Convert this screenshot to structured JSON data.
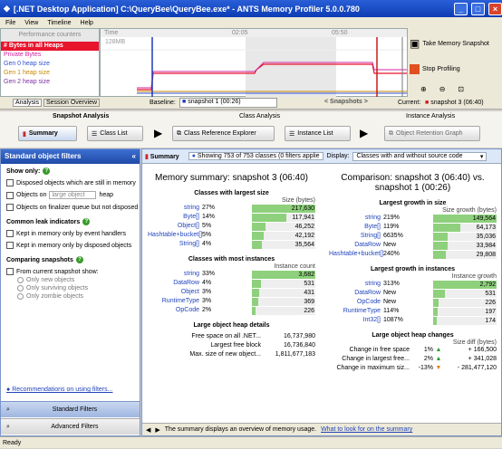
{
  "window": {
    "title": "[.NET Desktop Application] C:\\QueryBee\\QueryBee.exe* - ANTS Memory Profiler 5.0.0.780"
  },
  "menu": [
    "File",
    "View",
    "Timeline",
    "Help"
  ],
  "counters": {
    "header": "Performance counters",
    "items": [
      {
        "label": "# Bytes in all Heaps",
        "color": "#ffffff",
        "bg": "#e8152d"
      },
      {
        "label": "Private Bytes",
        "color": "#d3239b",
        "bg": ""
      },
      {
        "label": "Gen 0 heap size",
        "color": "#2f50cf",
        "bg": ""
      },
      {
        "label": "Gen 1 heap size",
        "color": "#c68a00",
        "bg": ""
      },
      {
        "label": "Gen 2 heap size",
        "color": "#7b2fa0",
        "bg": ""
      }
    ]
  },
  "timeline": {
    "header": "Time",
    "scale": "128MB",
    "ticks": [
      "02:05",
      "05:50"
    ]
  },
  "snapshot_buttons": {
    "take": "Take Memory Snapshot",
    "stop": "Stop Profiling"
  },
  "baseline": {
    "tab_analysis": "Analysis",
    "tab_session": "Session Overview",
    "label": "Baseline:",
    "value": "snapshot 1 (00:26)",
    "center": "< Snapshots >",
    "current_label": "Current:",
    "current_value": "snapshot 3 (06:40)"
  },
  "steps": {
    "snapshot_analysis": "Snapshot Analysis",
    "class_analysis": "Class Analysis",
    "instance_analysis": "Instance Analysis",
    "summary": "Summary",
    "class_list": "Class List",
    "class_reference_explorer": "Class Reference Explorer",
    "instance_list": "Instance List",
    "object_retention_graph": "Object Retention Graph"
  },
  "filters": {
    "title": "Standard object filters",
    "show_only": "Show only:",
    "disposed": "Disposed objects which are still in memory",
    "objects_on": "Objects on",
    "heap_select": "large object",
    "heap": "heap",
    "finalizer": "Objects on finalizer queue but not disposed",
    "leak_header": "Common leak indicators",
    "kept_handlers": "Kept in memory only by event handlers",
    "kept_disposed": "Kept in memory only by disposed objects",
    "comparing_header": "Comparing snapshots",
    "from_current": "From current snapshot show:",
    "only_new": "Only new objects",
    "only_surviving": "Only surviving objects",
    "only_zombie": "Only zombie objects",
    "recommendations": "Recommendations on using filters...",
    "standard_btn": "Standard Filters",
    "advanced_btn": "Advanced Filters"
  },
  "main": {
    "tab": "Summary",
    "showing": "Showing 753 of 753 classes (0 filters applie",
    "display_label": "Display:",
    "display_value": "Classes with and without source code",
    "left_title": "Memory summary: snapshot 3 (06:40)",
    "right_title": "Comparison: snapshot 3 (06:40) vs. snapshot 1 (00:26)",
    "largest_size": {
      "title": "Classes with largest size",
      "unit": "Size (bytes)",
      "rows": [
        [
          "string",
          "27%",
          "217,630",
          100
        ],
        [
          "Byte[]",
          "14%",
          "117,941",
          54
        ],
        [
          "Object[]",
          "5%",
          "46,252",
          21
        ],
        [
          "Hashtable+bucket[]",
          "5%",
          "42,192",
          19
        ],
        [
          "String[]",
          "4%",
          "35,564",
          16
        ]
      ]
    },
    "most_instances": {
      "title": "Classes with most instances",
      "unit": "Instance count",
      "rows": [
        [
          "string",
          "33%",
          "3,682",
          100
        ],
        [
          "DataRow",
          "4%",
          "531",
          14
        ],
        [
          "Object",
          "3%",
          "431",
          12
        ],
        [
          "RuntimeType",
          "3%",
          "369",
          10
        ],
        [
          "OpCode",
          "2%",
          "226",
          6
        ]
      ]
    },
    "loh": {
      "title": "Large object heap details",
      "rows": [
        [
          "Free space on all .NET...",
          "16,737,980"
        ],
        [
          "Largest free block",
          "16,736,840"
        ],
        [
          "Max. size of new object...",
          "1,811,677,183"
        ]
      ]
    },
    "growth_size": {
      "title": "Largest growth in size",
      "unit": "Size growth (bytes)",
      "rows": [
        [
          "string",
          "219%",
          "149,564",
          100
        ],
        [
          "Byte[]",
          "119%",
          "64,173",
          43
        ],
        [
          "String[]",
          "6635%",
          "35,036",
          23
        ],
        [
          "DataRow",
          "New",
          "33,984",
          23
        ],
        [
          "Hashtable+bucket[]",
          "240%",
          "29,808",
          20
        ]
      ]
    },
    "growth_instances": {
      "title": "Largest growth in instances",
      "unit": "Instance growth",
      "rows": [
        [
          "string",
          "313%",
          "2,792",
          100
        ],
        [
          "DataRow",
          "New",
          "531",
          19
        ],
        [
          "OpCode",
          "New",
          "226",
          8
        ],
        [
          "RuntimeType",
          "114%",
          "197",
          7
        ],
        [
          "Int32[]",
          "1087%",
          "174",
          6
        ]
      ]
    },
    "loh_changes": {
      "title": "Large object heap changes",
      "unit": "Size diff (bytes)",
      "rows": [
        [
          "Change in free space",
          "1%",
          "+ 166,500"
        ],
        [
          "Change in largest free...",
          "2%",
          "+ 341,028"
        ],
        [
          "Change in maximum siz...",
          "-13%",
          "- 281,477,120"
        ]
      ]
    },
    "footer": "The summary displays an overview of memory usage.",
    "footer_link": "What to look for on the summary"
  },
  "status": "Ready"
}
